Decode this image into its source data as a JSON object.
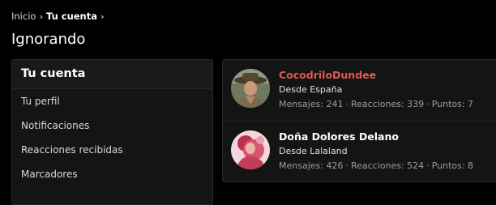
{
  "breadcrumb": {
    "home": "Inicio",
    "current": "Tu cuenta",
    "separator": "›"
  },
  "page": {
    "title": "Ignorando"
  },
  "sidebar": {
    "header": "Tu cuenta",
    "items": [
      {
        "label": "Tu perfil"
      },
      {
        "label": "Notificaciones"
      },
      {
        "label": "Reacciones recibidas"
      },
      {
        "label": "Marcadores"
      }
    ]
  },
  "members": [
    {
      "name": "CocodriloDundee",
      "location": "Desde España",
      "messages": "Mensajes: 241",
      "reactions": "Reacciones: 339",
      "points": "Puntos: 7",
      "name_color": "#e0584f"
    },
    {
      "name": "Doña Dolores Delano",
      "location": "Desde Lalaland",
      "messages": "Mensajes: 426",
      "reactions": "Reacciones: 524",
      "points": "Puntos: 8",
      "name_color": "#ffffff"
    }
  ],
  "colors": {
    "background": "#000000",
    "panel": "#141414",
    "staff_name": "#e0584f",
    "muted_text": "#9c9c9c"
  }
}
